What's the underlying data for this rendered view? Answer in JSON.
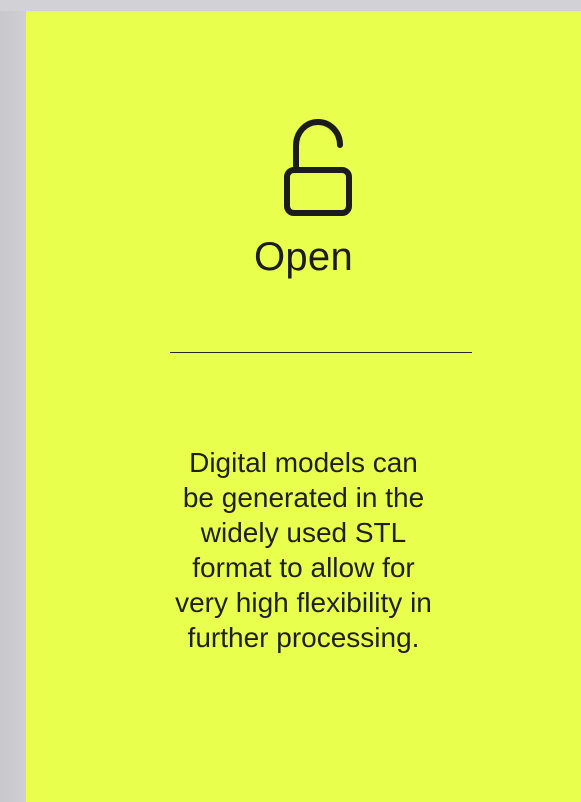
{
  "card": {
    "icon": "unlocked-padlock-icon",
    "title": "Open",
    "description": "Digital models can\nbe generated in the\nwidely used STL\nformat to allow for\nvery high flexibility in\nfurther processing.",
    "background_color": "#e8ff4d",
    "text_color": "#1c1c1c"
  }
}
